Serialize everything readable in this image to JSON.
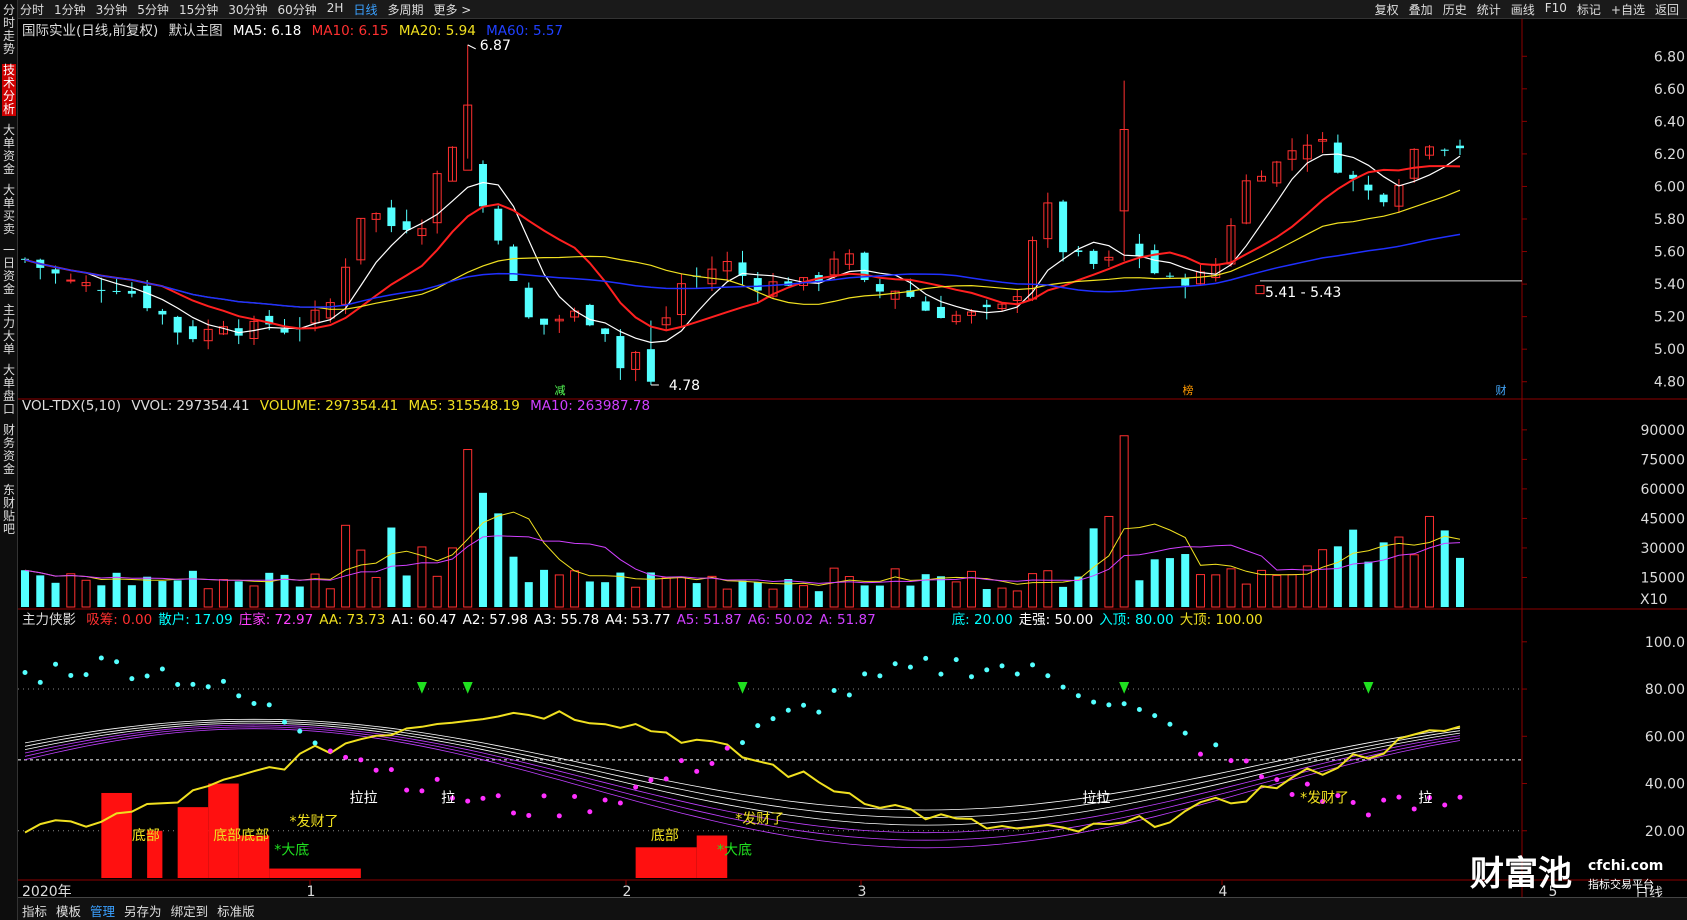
{
  "toolbar": {
    "tabs": [
      "分时",
      "1分钟",
      "3分钟",
      "5分钟",
      "15分钟",
      "30分钟",
      "60分钟",
      "2H",
      "日线",
      "多周期",
      "更多 >"
    ],
    "active_tab": "日线",
    "tools": [
      "复权",
      "叠加",
      "历史",
      "统计",
      "画线",
      "F10",
      "标记",
      "+自选",
      "返回"
    ]
  },
  "sidebar": {
    "items": [
      "分时走势",
      "技术分析",
      "大单资金",
      "大单买卖",
      "一日资金",
      "主力大单",
      "大单盘口",
      "财务资金",
      "东财贴吧"
    ],
    "active": "技术分析"
  },
  "main_panel": {
    "stock": "国际实业(日线,前复权)",
    "chart_name": "默认主图",
    "ma5": "MA5: 6.18",
    "ma10": "MA10: 6.15",
    "ma20": "MA20: 5.94",
    "ma60": "MA60: 5.57",
    "high_label": "6.87",
    "low_label": "4.78",
    "range_label": "5.41 - 5.43",
    "markers": [
      "减",
      "榜",
      "财"
    ],
    "y_ticks": [
      "6.80",
      "6.60",
      "6.40",
      "6.20",
      "6.00",
      "5.80",
      "5.60",
      "5.40",
      "5.20",
      "5.00",
      "4.80"
    ]
  },
  "volume_panel": {
    "name": "VOL-TDX(5,10)",
    "vvol": "VVOL: 297354.41",
    "volume": "VOLUME: 297354.41",
    "ma5": "MA5: 315548.19",
    "ma10": "MA10: 263987.78",
    "y_ticks": [
      "90000",
      "75000",
      "60000",
      "45000",
      "30000",
      "15000"
    ],
    "unit": "X10"
  },
  "indicator_panel": {
    "name": "主力侠影",
    "values": [
      "吸筹: 0.00",
      "散户: 17.09",
      "庄家: 72.97",
      "AA: 73.73",
      "A1: 60.47",
      "A2: 57.98",
      "A3: 55.78",
      "A4: 53.77",
      "A5: 51.87",
      "A6: 50.02",
      "A: 51.87"
    ],
    "thresholds": [
      "底: 20.00",
      "走强: 50.00",
      "入顶: 80.00",
      "大顶: 100.00"
    ],
    "y_ticks": [
      "100.0",
      "80.00",
      "60.00",
      "40.00",
      "20.00"
    ],
    "labels": {
      "bottom1": "底部",
      "bottom2": "底部底部",
      "bottom3": "底部",
      "dadi": "*大底",
      "facaile": "*发财了",
      "lala": "拉拉",
      "la": "拉"
    }
  },
  "x_axis": {
    "year": "2020年",
    "months": [
      "1",
      "2",
      "3",
      "4",
      "5"
    ],
    "period": "日线"
  },
  "bottom_bar": {
    "buttons": [
      "指标",
      "模板",
      "管理",
      "另存为",
      "绑定到",
      "标准版"
    ],
    "active": "管理"
  },
  "watermark": {
    "brand": "财富池",
    "site": "cfchi.com",
    "tagline": "指标交易平台"
  }
}
